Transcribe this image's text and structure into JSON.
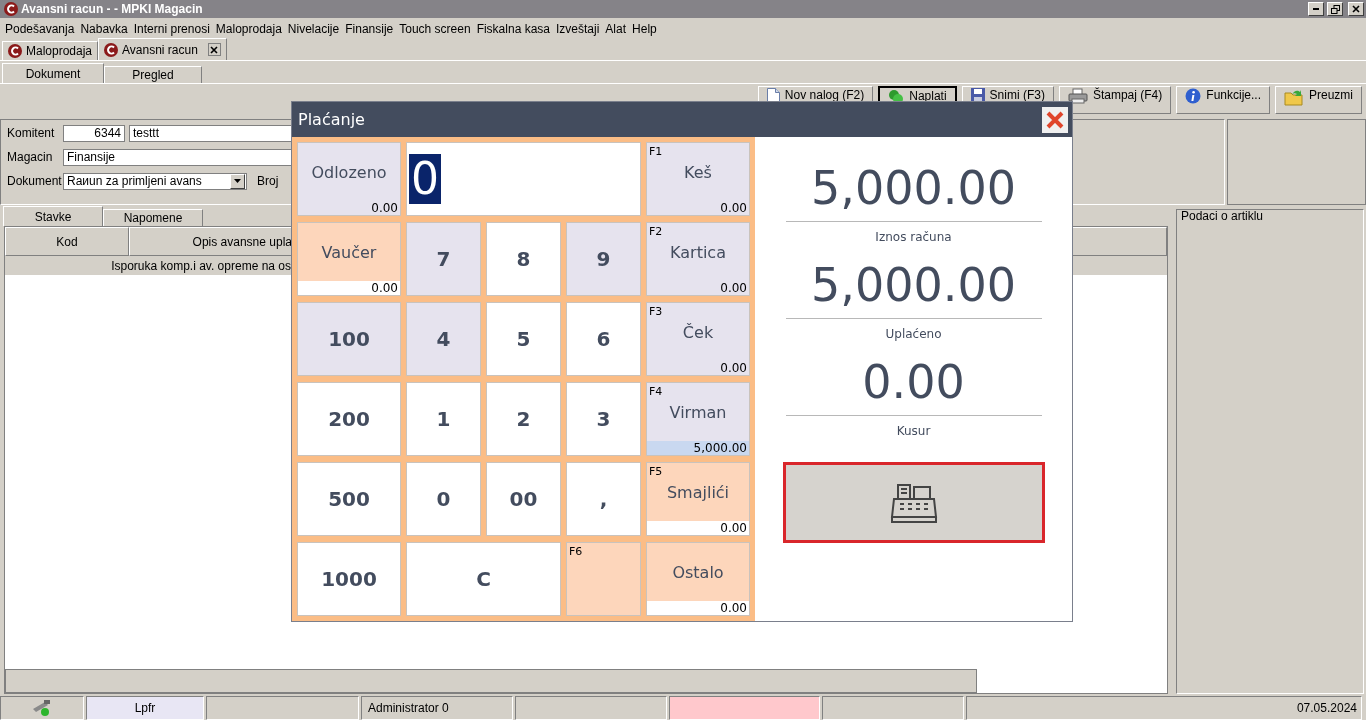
{
  "window": {
    "title": "Avansni racun -  - MPKI Magacin"
  },
  "menu": [
    {
      "label": "Podešavanja"
    },
    {
      "label": "Nabavka"
    },
    {
      "label": "Interni prenosi"
    },
    {
      "label": "Maloprodaja"
    },
    {
      "label": "Nivelacije"
    },
    {
      "label": "Finansije"
    },
    {
      "label": "Touch screen"
    },
    {
      "label": "Fiskalna kasa"
    },
    {
      "label": "Izveštaji"
    },
    {
      "label": "Alat"
    },
    {
      "label": "Help"
    }
  ],
  "doc_tabs": [
    {
      "label": "Maloprodaja",
      "selected": false,
      "closable": false
    },
    {
      "label": "Avansni racun",
      "selected": true,
      "closable": true
    }
  ],
  "view_tabs": [
    {
      "label": "Dokument",
      "selected": true
    },
    {
      "label": "Pregled",
      "selected": false
    }
  ],
  "toolbar": [
    {
      "label": "Nov nalog (F2)",
      "kind": "page",
      "focused": false
    },
    {
      "label": "Naplati",
      "kind": "money",
      "focused": true
    },
    {
      "label": "Snimi (F3)",
      "kind": "save",
      "focused": false
    },
    {
      "label": "Štampaj (F4)",
      "kind": "print",
      "focused": false
    },
    {
      "label": "Funkcije...",
      "kind": "info",
      "focused": false
    },
    {
      "label": "Preuzmi",
      "kind": "folder",
      "focused": false
    }
  ],
  "form": {
    "komitent_label": "Komitent",
    "komitent_code": "6344",
    "komitent_name": "testtt",
    "magacin_label": "Magacin",
    "magacin_value": "Finansije",
    "dokument_label": "Dokument",
    "dokument_value": "Raиun za primljeni avans",
    "broj_label": "Broj"
  },
  "item_tabs": [
    {
      "label": "Stavke",
      "selected": true
    },
    {
      "label": "Napomene",
      "selected": false
    }
  ],
  "table": {
    "columns": [
      "Kod",
      "Opis avansne upla"
    ],
    "group_row": "Isporuka komp.i av. opreme na os"
  },
  "article_panel": {
    "title": "Podaci o artiklu"
  },
  "status_bar": [
    {
      "kind": "icon",
      "color": "#d4d0c8"
    },
    {
      "text": "Lpfr",
      "color": "#e8e6f4"
    },
    {
      "color": "#d4d0c8"
    },
    {
      "text": "Administrator 0",
      "color": "#d4d0c8"
    },
    {
      "color": "#d4d0c8"
    },
    {
      "color": "#ffc8cc"
    },
    {
      "color": "#d4d0c8"
    },
    {
      "text": "07.05.2024",
      "color": "#d4d0c8"
    }
  ],
  "payment_dialog": {
    "title": "Plaćanje",
    "rows": [
      [
        {
          "kind": "tender",
          "label": "Odlozeno",
          "amount": "0.00",
          "color": "#e6e3ee",
          "selected": false
        },
        {
          "kind": "display",
          "value": "0"
        },
        "",
        "",
        {
          "kind": "tender",
          "hotkey": "F1",
          "label": "Keš",
          "amount": "0.00",
          "color": "#e6e3ee",
          "selected": false
        }
      ],
      [
        {
          "kind": "tender",
          "label": "Vaučer",
          "amount": "0.00",
          "color": "#fdd6bb",
          "selected": false
        },
        {
          "kind": "key",
          "label": "7",
          "color": "#e6e3ee"
        },
        {
          "kind": "key",
          "label": "8",
          "color": "#ffffff"
        },
        {
          "kind": "key",
          "label": "9",
          "color": "#e6e3ee"
        },
        {
          "kind": "tender",
          "hotkey": "F2",
          "label": "Kartica",
          "amount": "0.00",
          "color": "#e6e3ee",
          "selected": false
        }
      ],
      [
        {
          "kind": "key",
          "label": "100",
          "color": "#e6e3ee"
        },
        {
          "kind": "key",
          "label": "4",
          "color": "#e6e3ee"
        },
        {
          "kind": "key",
          "label": "5",
          "color": "#ffffff"
        },
        {
          "kind": "key",
          "label": "6",
          "color": "#ffffff"
        },
        {
          "kind": "tender",
          "hotkey": "F3",
          "label": "Ček",
          "amount": "0.00",
          "color": "#e6e3ee",
          "selected": false
        }
      ],
      [
        {
          "kind": "key",
          "label": "200",
          "color": "#ffffff"
        },
        {
          "kind": "key",
          "label": "1",
          "color": "#ffffff"
        },
        {
          "kind": "key",
          "label": "2",
          "color": "#ffffff"
        },
        {
          "kind": "key",
          "label": "3",
          "color": "#ffffff"
        },
        {
          "kind": "tender",
          "hotkey": "F4",
          "label": "Virman",
          "amount": "5,000.00",
          "color": "#e6e3ee",
          "selected": true
        }
      ],
      [
        {
          "kind": "key",
          "label": "500",
          "color": "#ffffff"
        },
        {
          "kind": "key",
          "label": "0",
          "color": "#ffffff"
        },
        {
          "kind": "key",
          "label": "00",
          "color": "#ffffff"
        },
        {
          "kind": "key",
          "label": ",",
          "color": "#ffffff"
        },
        {
          "kind": "tender",
          "hotkey": "F5",
          "label": "Smajlići",
          "amount": "0.00",
          "color": "#fdd6bb",
          "selected": false
        }
      ],
      [
        {
          "kind": "key",
          "label": "1000",
          "color": "#ffffff"
        },
        {
          "kind": "wide_key",
          "label": "C",
          "color": "#ffffff"
        },
        "",
        {
          "kind": "blank_tender",
          "hotkey": "F6",
          "color": "#fdd6bb"
        },
        {
          "kind": "tender",
          "label": "Ostalo",
          "amount": "0.00",
          "color": "#fdd6bb",
          "selected": false
        }
      ]
    ],
    "totals": [
      {
        "amount": "5,000.00",
        "label": "Iznos računa"
      },
      {
        "amount": "5,000.00",
        "label": "Uplaćeno"
      },
      {
        "amount": "0.00",
        "label": "Kusur"
      }
    ],
    "register_button": {
      "focused": true
    }
  }
}
